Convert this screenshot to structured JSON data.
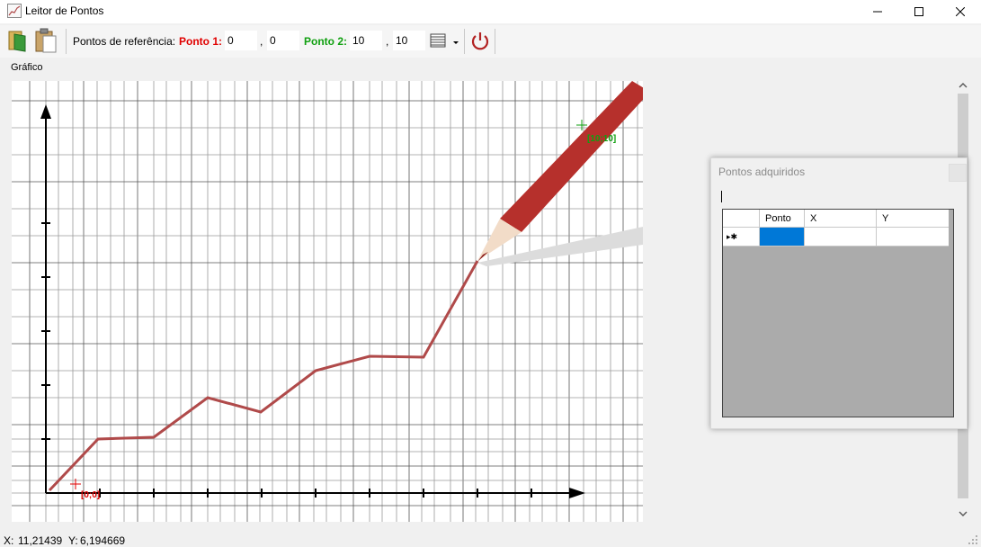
{
  "window": {
    "title": "Leitor de Pontos",
    "minimize_icon": "minimize-icon",
    "maximize_icon": "maximize-icon",
    "close_icon": "close-icon"
  },
  "toolbar": {
    "open_icon": "open-image-icon",
    "paste_icon": "paste-icon",
    "reference_label": "Pontos de referência:",
    "point1": {
      "label": "Ponto 1:",
      "x": "0",
      "y": "0",
      "color": "#e00000"
    },
    "point2": {
      "label": "Ponto 2:",
      "x": "10",
      "y": "10",
      "color": "#10a010"
    },
    "separator": ",",
    "list_icon": "list-view-icon",
    "dropdown_icon": "chevron-down-icon",
    "power_icon": "power-icon",
    "power_color": "#b22222"
  },
  "graph": {
    "label": "Gráfico",
    "marker1_label": "[0;0]",
    "marker2_label": "[10;10]",
    "line_color": "#b04a4a",
    "scroll_up_icon": "chevron-up-icon",
    "scroll_down_icon": "chevron-down-icon"
  },
  "panel": {
    "title": "Pontos adquiridos",
    "columns": [
      "Ponto",
      "X",
      "Y"
    ],
    "new_row_marker": "▸✱",
    "selection_color": "#0078d7"
  },
  "status": {
    "x_label": "X:",
    "x_value": "11,21439",
    "y_label": "Y:",
    "y_value": "6,194669"
  }
}
